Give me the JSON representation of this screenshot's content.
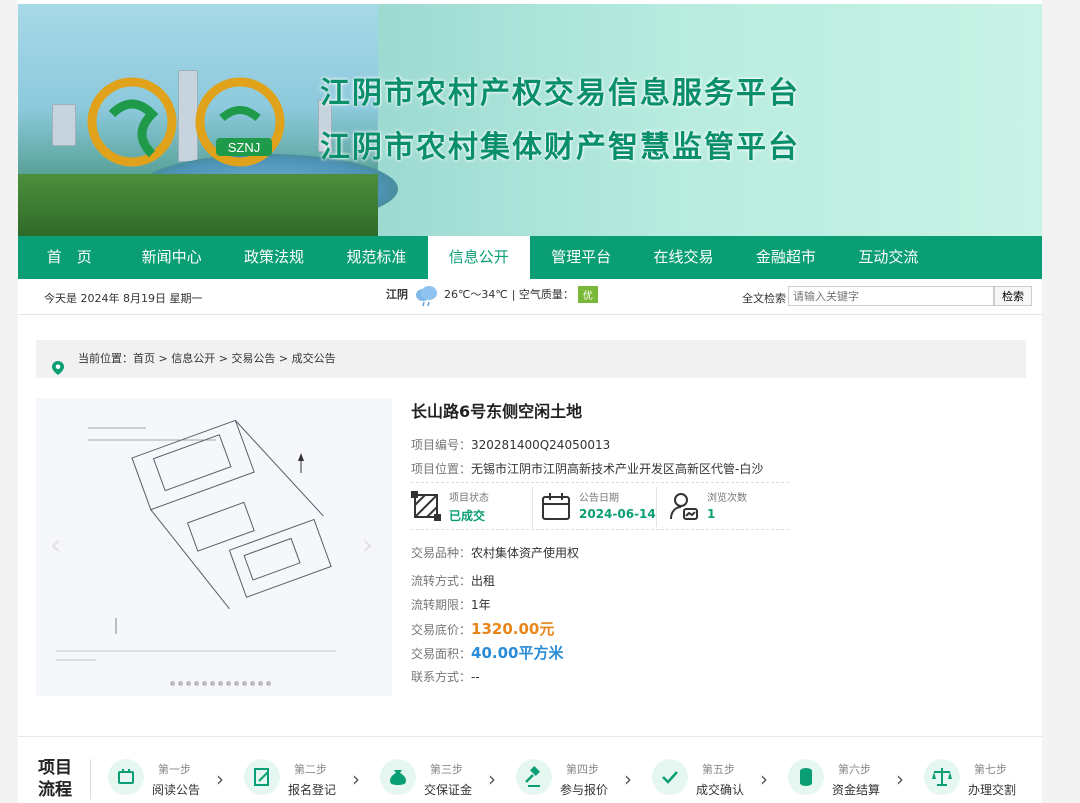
{
  "banner": {
    "title_line1": "江阴市农村产权交易信息服务平台",
    "title_line2": "江阴市农村集体财产智慧监管平台",
    "logo_text": "SZNJ"
  },
  "nav": {
    "items": [
      {
        "label": "首　页"
      },
      {
        "label": "新闻中心"
      },
      {
        "label": "政策法规"
      },
      {
        "label": "规范标准"
      },
      {
        "label": "信息公开"
      },
      {
        "label": "管理平台"
      },
      {
        "label": "在线交易"
      },
      {
        "label": "金融超市"
      },
      {
        "label": "互动交流"
      }
    ],
    "active_index": 4
  },
  "infobar": {
    "date": "今天是 2024年 8月19日 星期一",
    "city": "江阴",
    "temperature": "26℃～34℃",
    "aq_label": "| 空气质量：",
    "aq_value": "优",
    "search_label": "全文检索",
    "search_placeholder": "请输入关键字",
    "search_button": "检索"
  },
  "breadcrumb": {
    "text": "当前位置：首页 > 信息公开 > 交易公告 > 成交公告"
  },
  "project": {
    "title": "长山路6号东侧空闲土地",
    "code_label": "项目编号：",
    "code": "320281400Q24050013",
    "location_label": "项目位置：",
    "location": "无锡市江阴市江阴高新技术产业开发区高新区代管-白沙",
    "status_label": "项目状态",
    "status": "已成交",
    "date_label": "公告日期",
    "date": "2024-06-14",
    "views_label": "浏览次数",
    "views": "1",
    "variety_label": "交易品种：",
    "variety": "农村集体资产使用权",
    "method_label": "流转方式：",
    "method": "出租",
    "term_label": "流转期限：",
    "term": "1年",
    "price_label": "交易底价：",
    "price": "1320.00元",
    "area_label": "交易面积：",
    "area": "40.00平方米",
    "contact_label": "联系方式：",
    "contact": "--"
  },
  "process": {
    "title_line1": "项目",
    "title_line2": "流程",
    "steps": [
      {
        "step": "第一步",
        "name": "阅读公告"
      },
      {
        "step": "第二步",
        "name": "报名登记"
      },
      {
        "step": "第三步",
        "name": "交保证金"
      },
      {
        "step": "第四步",
        "name": "参与报价"
      },
      {
        "step": "第五步",
        "name": "成交确认"
      },
      {
        "step": "第六步",
        "name": "资金结算"
      },
      {
        "step": "第七步",
        "name": "办理交割"
      }
    ]
  },
  "colors": {
    "brand_green": "#0a9e74",
    "price_orange": "#e8851b",
    "area_blue": "#2a8cd6",
    "aq_green": "#7ab83a"
  }
}
